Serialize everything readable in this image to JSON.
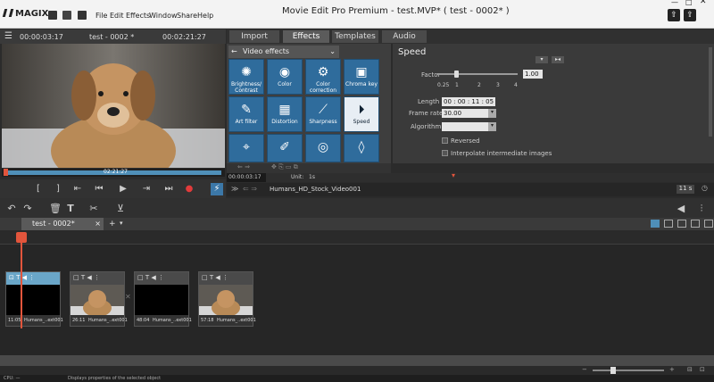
{
  "app": {
    "logo": "MAGIX",
    "title": "Movie Edit Pro Premium - test.MVP* ( test - 0002* )"
  },
  "menu": [
    "File",
    "Edit",
    "Effects",
    "Window",
    "Share",
    "Help"
  ],
  "preview": {
    "timecode_left": "00:00:03:17",
    "name": "test - 0002 *",
    "timecode_right": "00:02:21:27",
    "scrub_time": "02:21:27"
  },
  "tabs": [
    "Import",
    "Effects",
    "Templates",
    "Audio"
  ],
  "effects": {
    "category": "Video effects",
    "tiles": [
      {
        "label": "Brightness/ Contrast",
        "icon": "brightness-icon"
      },
      {
        "label": "Color",
        "icon": "palette-icon"
      },
      {
        "label": "Color correction",
        "icon": "color-correction-icon"
      },
      {
        "label": "Chroma key",
        "icon": "chroma-key-icon"
      },
      {
        "label": "Art filter",
        "icon": "art-filter-icon"
      },
      {
        "label": "Distortion",
        "icon": "distortion-icon"
      },
      {
        "label": "Sharpness",
        "icon": "sharpness-icon"
      },
      {
        "label": "Speed",
        "icon": "speed-icon"
      },
      {
        "label": "",
        "icon": "stabilize-icon"
      },
      {
        "label": "",
        "icon": "brush-icon"
      },
      {
        "label": "",
        "icon": "eye-icon"
      },
      {
        "label": "",
        "icon": "drop-icon"
      }
    ]
  },
  "speed": {
    "title": "Speed",
    "factor_label": "Factor",
    "factor_value": "1.00",
    "factor_ticks": [
      "0.25",
      "1",
      "2",
      "3",
      "4"
    ],
    "length_label": "Length",
    "length_value": "00 : 00 : 11 : 05",
    "framerate_label": "Frame rate",
    "framerate_value": "30.00",
    "algorithm_label": "Algorithm",
    "reversed_label": "Reversed",
    "interpolate_label": "Interpolate intermediate images"
  },
  "mini_timeline": {
    "timecode": "00:00:03:17",
    "unit_label": "Unit:",
    "unit_value": "1s"
  },
  "clipbar": {
    "clip_name": "Humans_HD_Stock_Video001",
    "duration": "11 s"
  },
  "project_tab": "test - 0002*",
  "clips": [
    {
      "start": "11:05",
      "name": "Humans_..ext001"
    },
    {
      "start": "26:11",
      "name": "Humans_..ext001"
    },
    {
      "start": "48:04",
      "name": "Humans_..ext001"
    },
    {
      "start": "57:18",
      "name": "Humans_..ext001"
    }
  ],
  "status": {
    "cpu": "CPU: —",
    "message": "Displays properties of the selected object"
  }
}
